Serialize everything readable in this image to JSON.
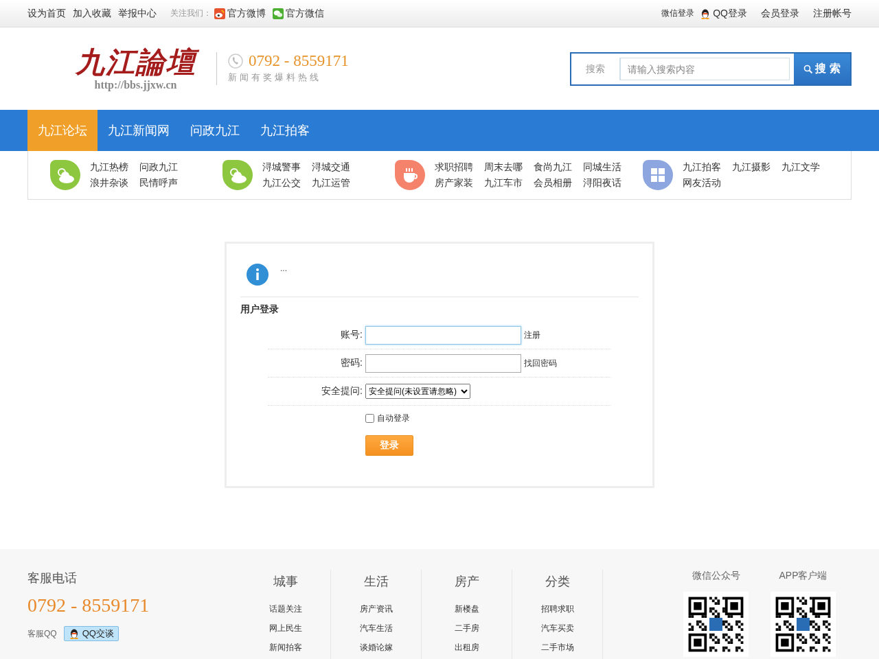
{
  "topbar": {
    "left_links": [
      "设为首页",
      "加入收藏",
      "举报中心"
    ],
    "follow_label": "关注我们：",
    "social": [
      {
        "label": "官方微博",
        "kind": "weibo"
      },
      {
        "label": "官方微信",
        "kind": "wechat"
      }
    ],
    "right_links": [
      {
        "label": "微信登录",
        "kind": "small"
      },
      {
        "label": "QQ登录",
        "kind": "qq"
      },
      {
        "label": "会员登录",
        "kind": "plain"
      },
      {
        "label": "注册帐号",
        "kind": "plain"
      }
    ]
  },
  "header": {
    "logo": {
      "title": "九江論壇",
      "url": "http://bbs.jjxw.cn"
    },
    "hotline": {
      "phone": "0792 - 8559171",
      "caption": "新闻有奖爆料热线"
    },
    "search": {
      "scope": "搜索",
      "placeholder": "请输入搜索内容",
      "button": "搜 索"
    }
  },
  "nav": [
    {
      "label": "九江论坛",
      "selected": true
    },
    {
      "label": "九江新闻网",
      "selected": false
    },
    {
      "label": "问政九江",
      "selected": false
    },
    {
      "label": "九江拍客",
      "selected": false
    }
  ],
  "subnav": [
    {
      "kind": "weather",
      "color": "#8dc63f",
      "links": [
        "九江热榜",
        "问政九江",
        "浪井杂谈",
        "民情呼声"
      ]
    },
    {
      "kind": "weather",
      "color": "#8dc63f",
      "links": [
        "浔城警事",
        "浔城交通",
        "九江公交",
        "九江运管"
      ]
    },
    {
      "kind": "cup",
      "color": "#f5836b",
      "links": [
        "求职招聘",
        "周末去哪",
        "食尚九江",
        "同城生活",
        "房产家装",
        "九江车市",
        "会员相册",
        "浔阳夜话"
      ]
    },
    {
      "kind": "grid",
      "color": "#8ea6e0",
      "links": [
        "九江拍客",
        "九江摄影",
        "九江文学",
        "网友活动"
      ]
    }
  ],
  "notice": {
    "message": "..."
  },
  "login": {
    "title": "用户登录",
    "fields": [
      {
        "label": "账号:",
        "kind": "text",
        "focused": true,
        "link": "注册"
      },
      {
        "label": "密码:",
        "kind": "password",
        "focused": false,
        "link": "找回密码"
      },
      {
        "label": "安全提问:",
        "kind": "select",
        "value": "安全提问(未设置请忽略)"
      }
    ],
    "auto_login": {
      "label": "自动登录",
      "checked": false
    },
    "submit": "登录"
  },
  "footer": {
    "service": {
      "title": "客服电话",
      "phone": "0792 - 8559171",
      "qq_label": "客服QQ",
      "qq_button": "QQ交谈"
    },
    "columns": [
      {
        "title": "城事",
        "links": [
          "话题关注",
          "网上民生",
          "新闻拍客"
        ]
      },
      {
        "title": "生活",
        "links": [
          "房产资讯",
          "汽车生活",
          "谈婚论嫁"
        ]
      },
      {
        "title": "房产",
        "links": [
          "新楼盘",
          "二手房",
          "出租房"
        ]
      },
      {
        "title": "分类",
        "links": [
          "招聘求职",
          "汽车买卖",
          "二手市场"
        ]
      }
    ],
    "qr_codes": [
      {
        "title": "微信公众号"
      },
      {
        "title": "APP客户端"
      }
    ]
  }
}
